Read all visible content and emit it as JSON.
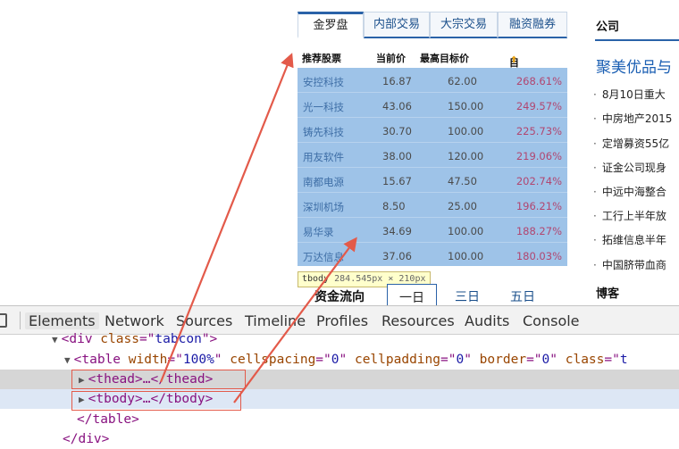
{
  "tabs": [
    "金罗盘",
    "内部交易",
    "大宗交易",
    "融资融券"
  ],
  "table_header": {
    "stock": "推荐股票",
    "current": "当前价",
    "max_target": "最高目标价",
    "target_space": "目标空间",
    "sort_icon": "arrow-up-icon"
  },
  "rows": [
    {
      "name": "安控科技",
      "current": "16.87",
      "target": "62.00",
      "space": "268.61%"
    },
    {
      "name": "光一科技",
      "current": "43.06",
      "target": "150.00",
      "space": "249.57%"
    },
    {
      "name": "铸先科技",
      "current": "30.70",
      "target": "100.00",
      "space": "225.73%"
    },
    {
      "name": "用友软件",
      "current": "38.00",
      "target": "120.00",
      "space": "219.06%"
    },
    {
      "name": "南都电源",
      "current": "15.67",
      "target": "47.50",
      "space": "202.74%"
    },
    {
      "name": "深圳机场",
      "current": "8.50",
      "target": "25.00",
      "space": "196.21%"
    },
    {
      "name": "易华录",
      "current": "34.69",
      "target": "100.00",
      "space": "188.27%"
    },
    {
      "name": "万达信息",
      "current": "37.06",
      "target": "100.00",
      "space": "180.03%"
    }
  ],
  "tooltip": {
    "tag": "tbody",
    "size": "284.545px × 210px"
  },
  "subtabs": {
    "title": "资金流向",
    "items": [
      "一日",
      "三日",
      "五日"
    ]
  },
  "right_column": {
    "section_title": "公司",
    "headline": "聚美优品与",
    "news": [
      "8月10日重大",
      "中房地产2015",
      "定增募资55亿",
      "证金公司现身",
      "中远中海整合",
      "工行上半年放",
      "拓维信息半年",
      "中国脐带血商"
    ],
    "blog_title": "博客"
  },
  "devtools": {
    "tabs": [
      "Elements",
      "Network",
      "Sources",
      "Timeline",
      "Profiles",
      "Resources",
      "Audits",
      "Console"
    ],
    "active_tab": "Elements",
    "lines": {
      "div": {
        "tag": "div",
        "attr": "class",
        "value": "tabcon"
      },
      "table": {
        "tag": "table",
        "attrs": [
          [
            "width",
            "100%"
          ],
          [
            "cellspacing",
            "0"
          ],
          [
            "cellpadding",
            "0"
          ],
          [
            "border",
            "0"
          ],
          [
            "class",
            "t"
          ]
        ]
      },
      "thead": "<thead>…</thead>",
      "tbody": "<tbody>…</tbody>",
      "table_close": "</table>",
      "div_close": "</div>"
    }
  },
  "colors": {
    "selection": "#9ec3e8",
    "accent": "#2a62a8",
    "annotation": "#e35a4a",
    "percent": "#b14670"
  }
}
